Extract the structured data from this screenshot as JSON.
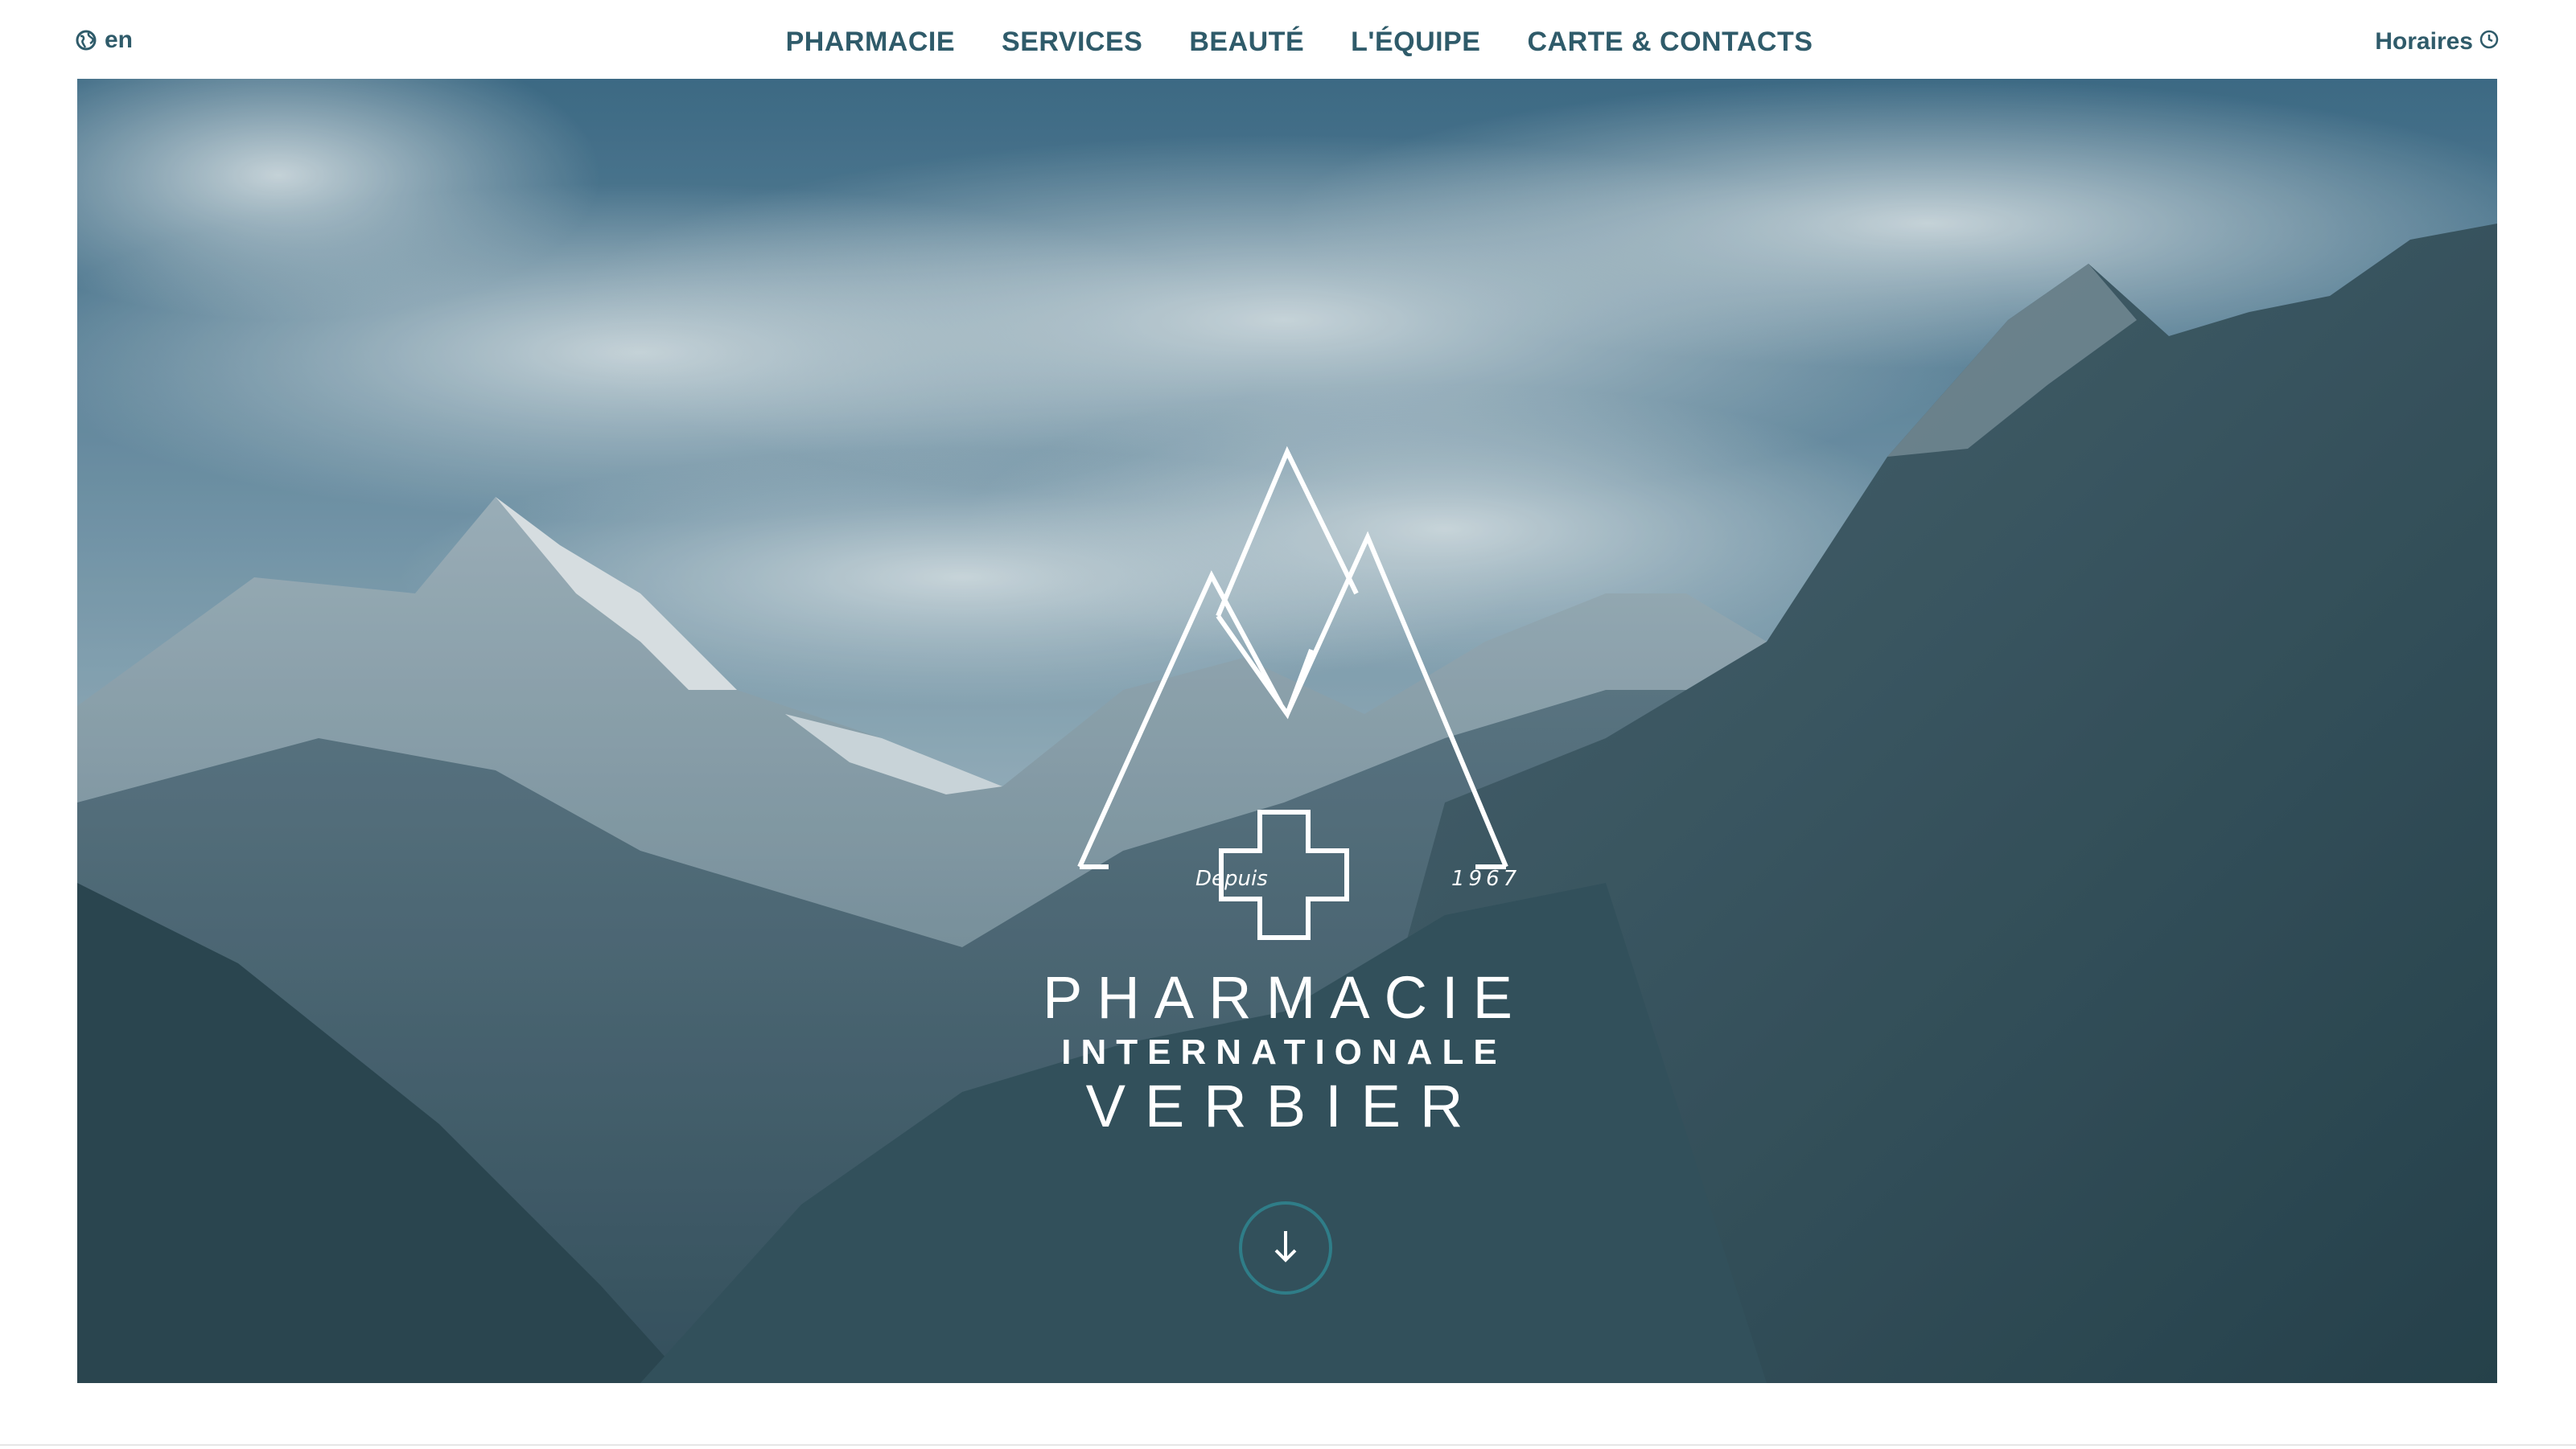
{
  "header": {
    "lang_label": "en",
    "nav_items": [
      {
        "label": "PHARMACIE"
      },
      {
        "label": "SERVICES"
      },
      {
        "label": "BEAUTÉ"
      },
      {
        "label": "L'ÉQUIPE"
      },
      {
        "label": "CARTE & CONTACTS"
      }
    ],
    "hours_label": "Horaires"
  },
  "hero": {
    "logo": {
      "since_label": "Depuis",
      "year": "1967",
      "line1": "PHARMACIE",
      "line2": "INTERNATIONALE",
      "line3": "VERBIER"
    },
    "scroll_icon": "arrow-down-icon"
  },
  "colors": {
    "nav_text": "#2f5b6a",
    "scroll_ring": "#2f7d88"
  }
}
